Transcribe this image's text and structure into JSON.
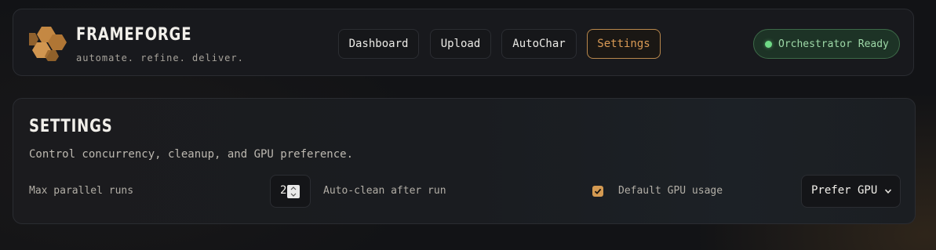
{
  "brand": {
    "title": "FRAMEFORGE",
    "tagline": "automate. refine. deliver."
  },
  "nav": {
    "items": [
      {
        "label": "Dashboard",
        "active": false
      },
      {
        "label": "Upload",
        "active": false
      },
      {
        "label": "AutoChar",
        "active": false
      },
      {
        "label": "Settings",
        "active": true
      }
    ]
  },
  "status": {
    "text": "Orchestrator Ready",
    "color": "#6fda86"
  },
  "settings": {
    "title": "SETTINGS",
    "description": "Control concurrency, cleanup, and GPU preference.",
    "max_parallel_label": "Max parallel runs",
    "max_parallel_value": "2",
    "auto_clean_label": "Auto-clean after run",
    "default_gpu_label": "Default GPU usage",
    "default_gpu_checked": true,
    "gpu_preference_value": "Prefer GPU"
  },
  "colors": {
    "accent": "#d49a52",
    "status_green": "#6fda86"
  },
  "icons": {
    "logo": "honeycomb-logo-icon",
    "status": "status-dot-icon",
    "checkbox": "checkmark-icon",
    "select": "chevron-down-icon",
    "spinner": "spinner-arrows-icon"
  }
}
